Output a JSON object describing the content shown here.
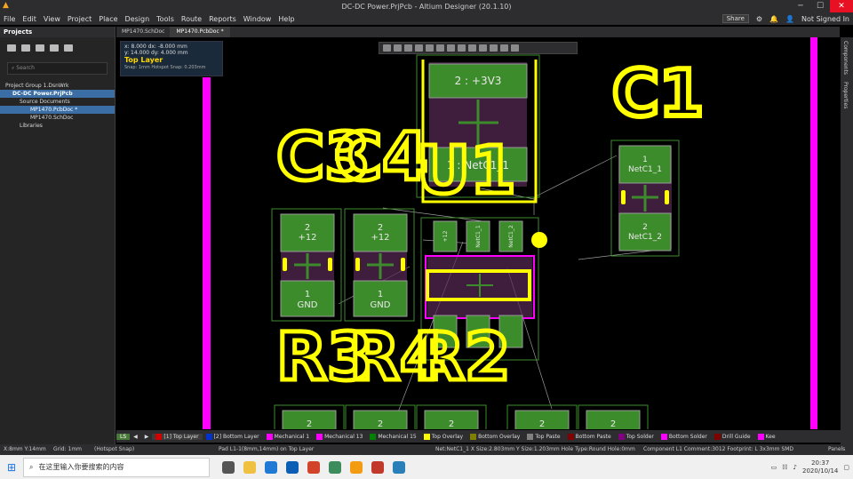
{
  "window": {
    "title": "DC-DC Power.PrjPcb - Altium Designer (20.1.10)",
    "min": "─",
    "max": "☐",
    "close": "✕"
  },
  "menu": {
    "items": [
      "File",
      "Edit",
      "View",
      "Project",
      "Place",
      "Design",
      "Tools",
      "Route",
      "Reports",
      "Window",
      "Help"
    ],
    "share": "Share",
    "user": "Not Signed In"
  },
  "projects": {
    "title": "Projects",
    "search_placeholder": "Search",
    "tree": [
      "Project Group 1.DsnWrk",
      "DC-DC Power.PrjPcb",
      "Source Documents",
      "MP1470.PcbDoc *",
      "MP1470.SchDoc",
      "Libraries"
    ]
  },
  "doc_tabs": [
    "MP1470.SchDoc",
    "MP1470.PcbDoc *"
  ],
  "right_panels": [
    "Components",
    "Properties"
  ],
  "coords": {
    "line1": "x:  8.000   dx: -8.000 mm",
    "line2": "y: 14.000   dy:  4.000 mm",
    "layer": "Top Layer",
    "snap": "Snap: 1mm Hotspot Snap: 0.203mm"
  },
  "pcb": {
    "designators": [
      "C1",
      "C3",
      "C4",
      "U1",
      "R3",
      "R4",
      "R2"
    ],
    "pads": {
      "top_2": "2 : +3V3",
      "top_1": "1 : NetC1_1",
      "c1_1a": "1",
      "c1_1b": "NetC1_1",
      "c1_2a": "2",
      "c1_2b": "NetC1_2",
      "c3_2a": "2",
      "c3_2b": "+12",
      "c3_1a": "1",
      "c3_1b": "GND",
      "c4_2a": "2",
      "c4_2b": "+12",
      "c4_1a": "1",
      "c4_1b": "GND",
      "u1_p1": "+12",
      "u1_p2": "NetC1_1",
      "u1_p3": "NetC1_2",
      "bottom": [
        "2",
        "2",
        "2",
        "2",
        "2"
      ]
    },
    "colors": {
      "board_outline": "#ff00ff",
      "silk": "#ffff00",
      "pad": "#3c8c2c",
      "keepout": "#6b2f5f"
    }
  },
  "layers": {
    "scale": "LS",
    "items": [
      {
        "label": "[1] Top Layer",
        "color": "#d40000"
      },
      {
        "label": "[2] Bottom Layer",
        "color": "#0033cc"
      },
      {
        "label": "Mechanical 1",
        "color": "#ff00ff"
      },
      {
        "label": "Mechanical 13",
        "color": "#ff00ff"
      },
      {
        "label": "Mechanical 15",
        "color": "#008000"
      },
      {
        "label": "Top Overlay",
        "color": "#ffff00"
      },
      {
        "label": "Bottom Overlay",
        "color": "#808000"
      },
      {
        "label": "Top Paste",
        "color": "#808080"
      },
      {
        "label": "Bottom Paste",
        "color": "#800000"
      },
      {
        "label": "Top Solder",
        "color": "#800080"
      },
      {
        "label": "Bottom Solder",
        "color": "#ff00ff"
      },
      {
        "label": "Drill Guide",
        "color": "#800000"
      },
      {
        "label": "Kee",
        "color": "#ff00ff"
      }
    ]
  },
  "status": {
    "xy": "X:8mm Y:14mm",
    "grid": "Grid: 1mm",
    "snap": "(Hotspot Snap)",
    "pad": "Pad L1-1(8mm,14mm) on Top Layer",
    "net": "Net:NetC1_1 X Size:2.803mm Y Size:1.203mm Hole Type:Round Hole:0mm",
    "component": "Component L1 Comment:3012 Footprint: L 3x3mm SMD",
    "panels": "Panels"
  },
  "taskbar": {
    "search": "在这里输入你要搜索的内容",
    "time": "20:37",
    "date": "2020/10/14"
  }
}
